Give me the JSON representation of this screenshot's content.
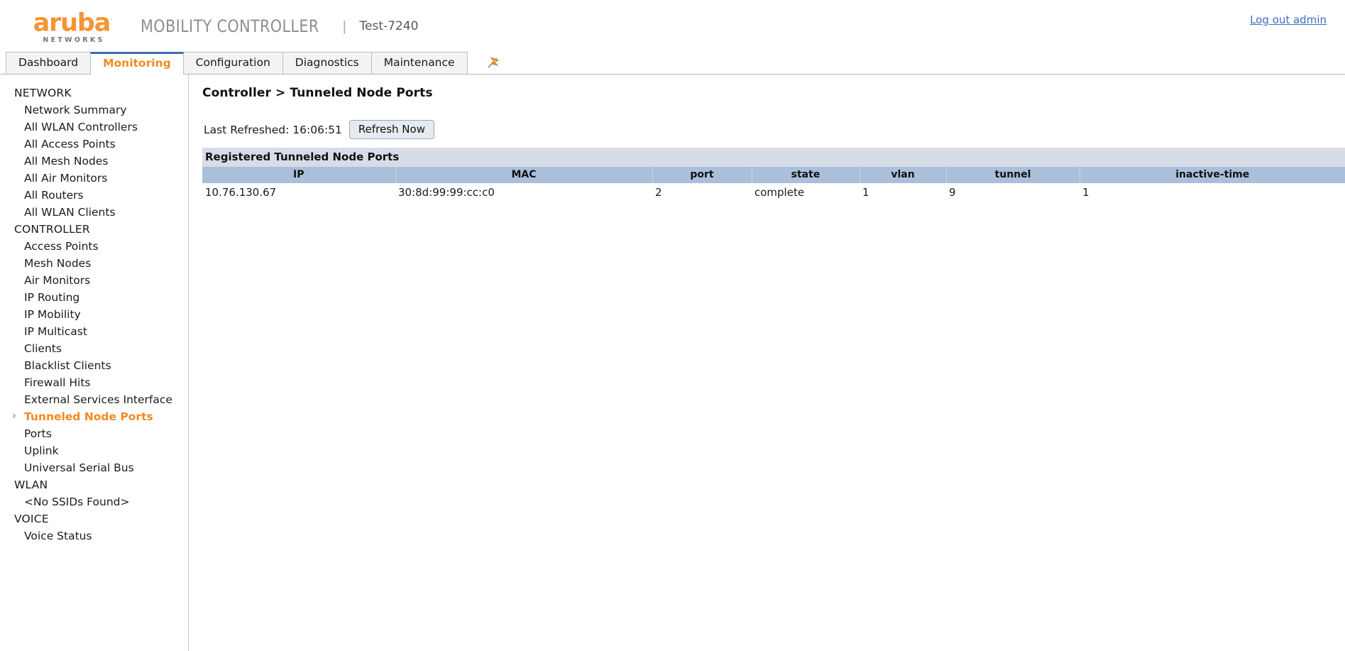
{
  "banner": {
    "logo_word": "aruba",
    "logo_registered": "·",
    "logo_sub": "NETWORKS",
    "product_name": "MOBILITY CONTROLLER",
    "separator": "|",
    "host_name": "Test-7240",
    "logout_label": "Log out admin"
  },
  "tabs": [
    {
      "label": "Dashboard",
      "active": false
    },
    {
      "label": "Monitoring",
      "active": true
    },
    {
      "label": "Configuration",
      "active": false
    },
    {
      "label": "Diagnostics",
      "active": false
    },
    {
      "label": "Maintenance",
      "active": false
    }
  ],
  "tab_icon": "pushpin-flag-icon",
  "sidebar": {
    "groups": [
      {
        "title": "NETWORK",
        "items": [
          {
            "label": "Network Summary",
            "selected": false
          },
          {
            "label": "All WLAN Controllers",
            "selected": false
          },
          {
            "label": "All Access Points",
            "selected": false
          },
          {
            "label": "All Mesh Nodes",
            "selected": false
          },
          {
            "label": "All Air Monitors",
            "selected": false
          },
          {
            "label": "All Routers",
            "selected": false
          },
          {
            "label": "All WLAN Clients",
            "selected": false
          }
        ]
      },
      {
        "title": "CONTROLLER",
        "items": [
          {
            "label": "Access Points",
            "selected": false
          },
          {
            "label": "Mesh Nodes",
            "selected": false
          },
          {
            "label": "Air Monitors",
            "selected": false
          },
          {
            "label": "IP Routing",
            "selected": false
          },
          {
            "label": "IP Mobility",
            "selected": false
          },
          {
            "label": "IP Multicast",
            "selected": false
          },
          {
            "label": "Clients",
            "selected": false
          },
          {
            "label": "Blacklist Clients",
            "selected": false
          },
          {
            "label": "Firewall Hits",
            "selected": false
          },
          {
            "label": "External Services Interface",
            "selected": false
          },
          {
            "label": "Tunneled Node Ports",
            "selected": true
          },
          {
            "label": "Ports",
            "selected": false
          },
          {
            "label": "Uplink",
            "selected": false
          },
          {
            "label": "Universal Serial Bus",
            "selected": false
          }
        ]
      },
      {
        "title": "WLAN",
        "items": [
          {
            "label": "<No SSIDs Found>",
            "selected": false
          }
        ]
      },
      {
        "title": "VOICE",
        "items": [
          {
            "label": "Voice Status",
            "selected": false
          }
        ]
      }
    ],
    "selected_chevron": "›"
  },
  "main": {
    "page_title": "Controller > Tunneled Node Ports",
    "refresh_label": "Last Refreshed: 16:06:51",
    "refresh_button": "Refresh Now",
    "table": {
      "caption": "Registered Tunneled Node Ports",
      "columns": [
        "IP",
        "MAC",
        "port",
        "state",
        "vlan",
        "tunnel",
        "inactive-time"
      ],
      "rows": [
        {
          "ip": "10.76.130.67",
          "mac": "30:8d:99:99:cc:c0",
          "port": "2",
          "state": "complete",
          "vlan": "1",
          "tunnel": "9",
          "inactive_time": "1"
        }
      ]
    }
  },
  "colors": {
    "brand_orange": "#f79433",
    "active_tab_text": "#f08a24",
    "active_tab_topline": "#3f6daa",
    "link_blue": "#3b6fc4",
    "table_caption_bg": "#d7dde7",
    "table_header_bg": "#a9bfda",
    "chevron_blue": "#7a93b3"
  }
}
